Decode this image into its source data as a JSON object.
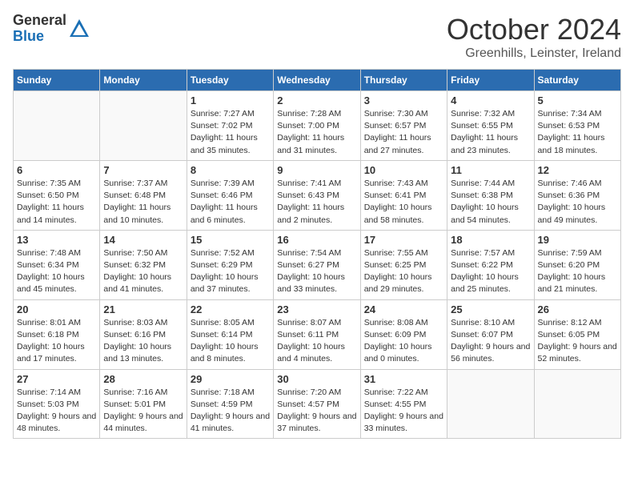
{
  "header": {
    "logo_general": "General",
    "logo_blue": "Blue",
    "month_title": "October 2024",
    "location": "Greenhills, Leinster, Ireland"
  },
  "weekdays": [
    "Sunday",
    "Monday",
    "Tuesday",
    "Wednesday",
    "Thursday",
    "Friday",
    "Saturday"
  ],
  "weeks": [
    [
      {
        "day": "",
        "info": ""
      },
      {
        "day": "",
        "info": ""
      },
      {
        "day": "1",
        "info": "Sunrise: 7:27 AM\nSunset: 7:02 PM\nDaylight: 11 hours and 35 minutes."
      },
      {
        "day": "2",
        "info": "Sunrise: 7:28 AM\nSunset: 7:00 PM\nDaylight: 11 hours and 31 minutes."
      },
      {
        "day": "3",
        "info": "Sunrise: 7:30 AM\nSunset: 6:57 PM\nDaylight: 11 hours and 27 minutes."
      },
      {
        "day": "4",
        "info": "Sunrise: 7:32 AM\nSunset: 6:55 PM\nDaylight: 11 hours and 23 minutes."
      },
      {
        "day": "5",
        "info": "Sunrise: 7:34 AM\nSunset: 6:53 PM\nDaylight: 11 hours and 18 minutes."
      }
    ],
    [
      {
        "day": "6",
        "info": "Sunrise: 7:35 AM\nSunset: 6:50 PM\nDaylight: 11 hours and 14 minutes."
      },
      {
        "day": "7",
        "info": "Sunrise: 7:37 AM\nSunset: 6:48 PM\nDaylight: 11 hours and 10 minutes."
      },
      {
        "day": "8",
        "info": "Sunrise: 7:39 AM\nSunset: 6:46 PM\nDaylight: 11 hours and 6 minutes."
      },
      {
        "day": "9",
        "info": "Sunrise: 7:41 AM\nSunset: 6:43 PM\nDaylight: 11 hours and 2 minutes."
      },
      {
        "day": "10",
        "info": "Sunrise: 7:43 AM\nSunset: 6:41 PM\nDaylight: 10 hours and 58 minutes."
      },
      {
        "day": "11",
        "info": "Sunrise: 7:44 AM\nSunset: 6:38 PM\nDaylight: 10 hours and 54 minutes."
      },
      {
        "day": "12",
        "info": "Sunrise: 7:46 AM\nSunset: 6:36 PM\nDaylight: 10 hours and 49 minutes."
      }
    ],
    [
      {
        "day": "13",
        "info": "Sunrise: 7:48 AM\nSunset: 6:34 PM\nDaylight: 10 hours and 45 minutes."
      },
      {
        "day": "14",
        "info": "Sunrise: 7:50 AM\nSunset: 6:32 PM\nDaylight: 10 hours and 41 minutes."
      },
      {
        "day": "15",
        "info": "Sunrise: 7:52 AM\nSunset: 6:29 PM\nDaylight: 10 hours and 37 minutes."
      },
      {
        "day": "16",
        "info": "Sunrise: 7:54 AM\nSunset: 6:27 PM\nDaylight: 10 hours and 33 minutes."
      },
      {
        "day": "17",
        "info": "Sunrise: 7:55 AM\nSunset: 6:25 PM\nDaylight: 10 hours and 29 minutes."
      },
      {
        "day": "18",
        "info": "Sunrise: 7:57 AM\nSunset: 6:22 PM\nDaylight: 10 hours and 25 minutes."
      },
      {
        "day": "19",
        "info": "Sunrise: 7:59 AM\nSunset: 6:20 PM\nDaylight: 10 hours and 21 minutes."
      }
    ],
    [
      {
        "day": "20",
        "info": "Sunrise: 8:01 AM\nSunset: 6:18 PM\nDaylight: 10 hours and 17 minutes."
      },
      {
        "day": "21",
        "info": "Sunrise: 8:03 AM\nSunset: 6:16 PM\nDaylight: 10 hours and 13 minutes."
      },
      {
        "day": "22",
        "info": "Sunrise: 8:05 AM\nSunset: 6:14 PM\nDaylight: 10 hours and 8 minutes."
      },
      {
        "day": "23",
        "info": "Sunrise: 8:07 AM\nSunset: 6:11 PM\nDaylight: 10 hours and 4 minutes."
      },
      {
        "day": "24",
        "info": "Sunrise: 8:08 AM\nSunset: 6:09 PM\nDaylight: 10 hours and 0 minutes."
      },
      {
        "day": "25",
        "info": "Sunrise: 8:10 AM\nSunset: 6:07 PM\nDaylight: 9 hours and 56 minutes."
      },
      {
        "day": "26",
        "info": "Sunrise: 8:12 AM\nSunset: 6:05 PM\nDaylight: 9 hours and 52 minutes."
      }
    ],
    [
      {
        "day": "27",
        "info": "Sunrise: 7:14 AM\nSunset: 5:03 PM\nDaylight: 9 hours and 48 minutes."
      },
      {
        "day": "28",
        "info": "Sunrise: 7:16 AM\nSunset: 5:01 PM\nDaylight: 9 hours and 44 minutes."
      },
      {
        "day": "29",
        "info": "Sunrise: 7:18 AM\nSunset: 4:59 PM\nDaylight: 9 hours and 41 minutes."
      },
      {
        "day": "30",
        "info": "Sunrise: 7:20 AM\nSunset: 4:57 PM\nDaylight: 9 hours and 37 minutes."
      },
      {
        "day": "31",
        "info": "Sunrise: 7:22 AM\nSunset: 4:55 PM\nDaylight: 9 hours and 33 minutes."
      },
      {
        "day": "",
        "info": ""
      },
      {
        "day": "",
        "info": ""
      }
    ]
  ]
}
